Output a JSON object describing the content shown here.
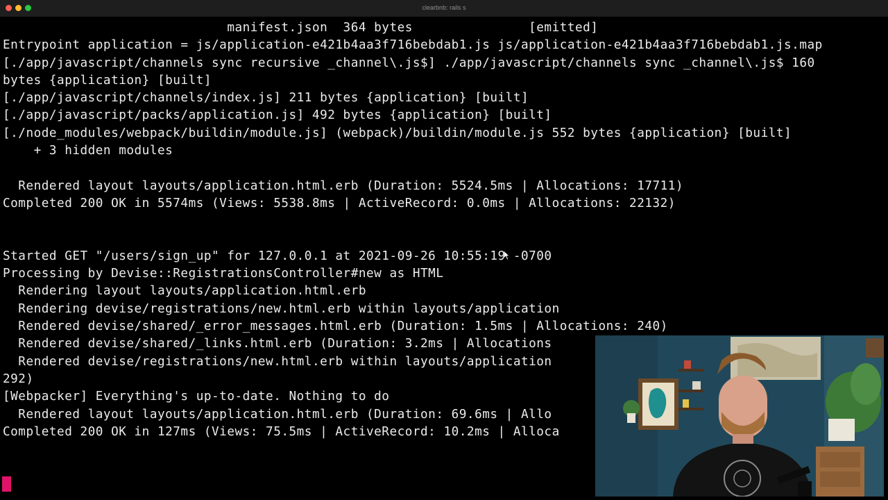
{
  "window": {
    "title": "clearbnb: rails s",
    "colors": {
      "close": "#fe5f57",
      "minimize": "#febc2e",
      "maximize": "#28c840"
    }
  },
  "terminal": {
    "lines": [
      "                             manifest.json  364 bytes               [emitted]",
      "Entrypoint application = js/application-e421b4aa3f716bebdab1.js js/application-e421b4aa3f716bebdab1.js.map",
      "[./app/javascript/channels sync recursive _channel\\.js$] ./app/javascript/channels sync _channel\\.js$ 160",
      "bytes {application} [built]",
      "[./app/javascript/channels/index.js] 211 bytes {application} [built]",
      "[./app/javascript/packs/application.js] 492 bytes {application} [built]",
      "[./node_modules/webpack/buildin/module.js] (webpack)/buildin/module.js 552 bytes {application} [built]",
      "    + 3 hidden modules",
      "",
      "  Rendered layout layouts/application.html.erb (Duration: 5524.5ms | Allocations: 17711)",
      "Completed 200 OK in 5574ms (Views: 5538.8ms | ActiveRecord: 0.0ms | Allocations: 22132)",
      "",
      "",
      "Started GET \"/users/sign_up\" for 127.0.0.1 at 2021-09-26 10:55:19 -0700",
      "Processing by Devise::RegistrationsController#new as HTML",
      "  Rendering layout layouts/application.html.erb",
      "  Rendering devise/registrations/new.html.erb within layouts/application",
      "  Rendered devise/shared/_error_messages.html.erb (Duration: 1.5ms | Allocations: 240)",
      "  Rendered devise/shared/_links.html.erb (Duration: 3.2ms | Allocations",
      "  Rendered devise/registrations/new.html.erb within layouts/application",
      "292)",
      "[Webpacker] Everything's up-to-date. Nothing to do",
      "  Rendered layout layouts/application.html.erb (Duration: 69.6ms | Allo",
      "Completed 200 OK in 127ms (Views: 75.5ms | ActiveRecord: 10.2ms | Alloca"
    ],
    "cursor_color": "#e0136a"
  }
}
